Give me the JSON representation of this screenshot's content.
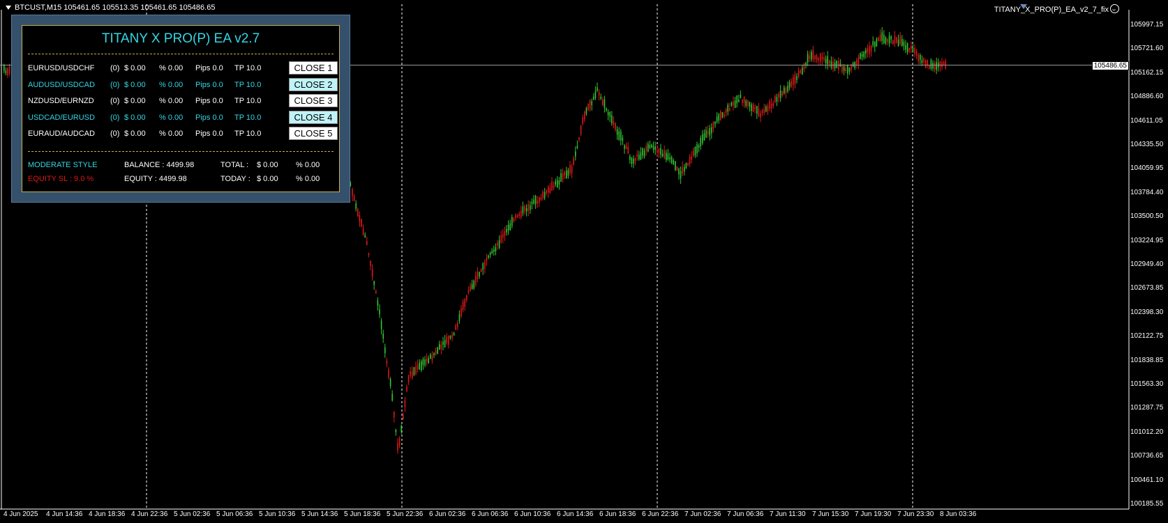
{
  "chart": {
    "symbol_line": "BTCUST,M15  105461.65 105513.35 105461.65 105486.65",
    "ea_name": "TITANY_X_PRO(P)_EA_v2_7_fix",
    "current_price": "105486.65",
    "price_labels": [
      "105997.15",
      "105721.60",
      "105162.15",
      "104886.60",
      "104611.05",
      "104335.50",
      "104059.95",
      "103784.40",
      "103500.50",
      "103224.95",
      "102949.40",
      "102673.85",
      "102398.30",
      "102122.75",
      "101838.85",
      "101563.30",
      "101287.75",
      "101012.20",
      "100736.65",
      "100461.10",
      "100185.55"
    ],
    "time_labels": [
      "4 Jun 2025",
      "4 Jun 14:36",
      "4 Jun 18:36",
      "4 Jun 22:36",
      "5 Jun 02:36",
      "5 Jun 06:36",
      "5 Jun 10:36",
      "5 Jun 14:36",
      "5 Jun 18:36",
      "5 Jun 22:36",
      "6 Jun 02:36",
      "6 Jun 06:36",
      "6 Jun 10:36",
      "6 Jun 14:36",
      "6 Jun 18:36",
      "6 Jun 22:36",
      "7 Jun 02:36",
      "7 Jun 06:36",
      "7 Jun 11:30",
      "7 Jun 15:30",
      "7 Jun 19:30",
      "7 Jun 23:30",
      "8 Jun 03:36"
    ],
    "colors": {
      "bull": "#32c832",
      "bear": "#e01818",
      "grid": "#ffffff",
      "axis": "#ffffff"
    }
  },
  "panel": {
    "title": "TITANY X PRO(P) EA v2.7",
    "rows": [
      {
        "pair": "EURUSD/USDCHF",
        "count": "(0)",
        "profit": "$ 0.00",
        "pct": "% 0.00",
        "pips": "Pips 0.0",
        "tp": "TP 10.0",
        "button": "CLOSE 1",
        "style": "white"
      },
      {
        "pair": "AUDUSD/USDCAD",
        "count": "(0)",
        "profit": "$ 0.00",
        "pct": "% 0.00",
        "pips": "Pips 0.0",
        "tp": "TP 10.0",
        "button": "CLOSE 2",
        "style": "cyan"
      },
      {
        "pair": "NZDUSD/EURNZD",
        "count": "(0)",
        "profit": "$ 0.00",
        "pct": "% 0.00",
        "pips": "Pips 0.0",
        "tp": "TP 10.0",
        "button": "CLOSE 3",
        "style": "white"
      },
      {
        "pair": "USDCAD/EURUSD",
        "count": "(0)",
        "profit": "$ 0.00",
        "pct": "% 0.00",
        "pips": "Pips 0.0",
        "tp": "TP 10.0",
        "button": "CLOSE 4",
        "style": "cyan"
      },
      {
        "pair": "EURAUD/AUDCAD",
        "count": "(0)",
        "profit": "$ 0.00",
        "pct": "% 0.00",
        "pips": "Pips 0.0",
        "tp": "TP 10.0",
        "button": "CLOSE 5",
        "style": "white"
      }
    ],
    "style_label": "MODERATE STYLE",
    "equity_sl": "EQUITY SL : 9.0 %",
    "balance": "BALANCE : 4499.98",
    "equity": "EQUITY : 4499.98",
    "total_label": "TOTAL :",
    "total_amount": "$ 0.00",
    "total_pct": "% 0.00",
    "today_label": "TODAY :",
    "today_amount": "$ 0.00",
    "today_pct": "% 0.00"
  }
}
